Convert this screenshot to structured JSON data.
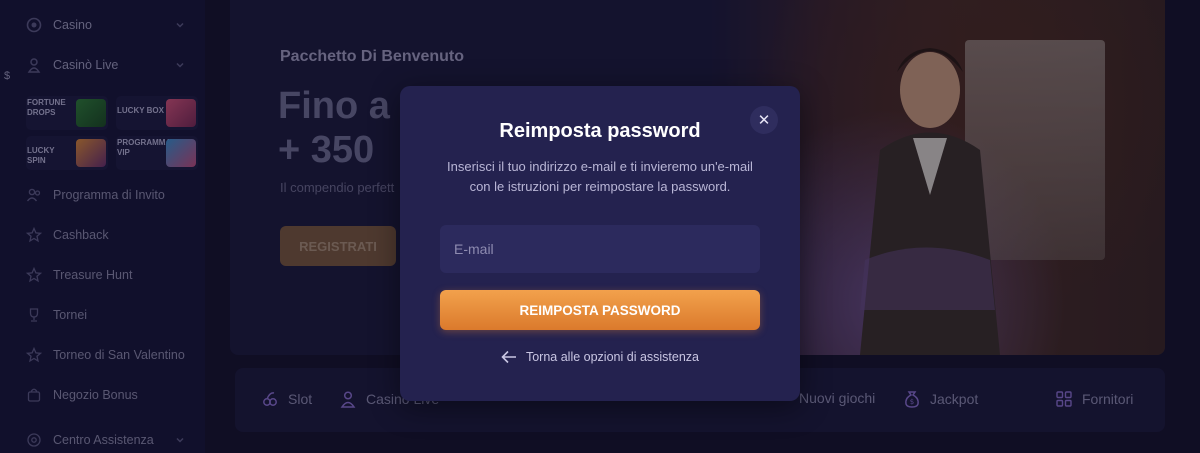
{
  "sidebar": {
    "items_top": [
      {
        "label": "Casino",
        "icon": "casino-chip-icon",
        "has_chevron": true
      },
      {
        "label": "Casinò Live",
        "icon": "live-dealer-icon",
        "has_chevron": true
      }
    ],
    "promos": [
      {
        "label": "FORTUNE DROPS",
        "icon": "fortune-drops-image"
      },
      {
        "label": "LUCKY BOX",
        "icon": "lucky-box-image"
      },
      {
        "label": "LUCKY SPIN",
        "icon": "lucky-spin-image"
      },
      {
        "label": "PROGRAMMA VIP",
        "icon": "vip-program-image"
      }
    ],
    "items": [
      {
        "label": "Programma di Invito",
        "icon": "users-icon"
      },
      {
        "label": "Cashback",
        "icon": "star-icon"
      },
      {
        "label": "Treasure Hunt",
        "icon": "star-icon"
      },
      {
        "label": "Tornei",
        "icon": "trophy-icon"
      },
      {
        "label": "Torneo di San Valentino",
        "icon": "star-icon"
      },
      {
        "label": "Negozio Bonus",
        "icon": "shopping-bag-icon"
      },
      {
        "label": "Centro Assistenza",
        "icon": "support-icon",
        "has_chevron": true
      }
    ],
    "stray_char": "$"
  },
  "banner": {
    "welcome": "Pacchetto Di Benvenuto",
    "headline_line1": "Fino a",
    "headline_line2": "+ 350",
    "subline": "Il compendio perfett",
    "register_label": "REGISTRATI"
  },
  "categories": [
    {
      "label": "Slot",
      "icon": "slot-icon"
    },
    {
      "label": "Casinò Live",
      "icon": "live-dealer-icon"
    },
    {
      "label": "Nuovi giochi",
      "icon": "new-games-icon"
    },
    {
      "label": "Jackpot",
      "icon": "jackpot-bag-icon"
    },
    {
      "label": "Fornitori",
      "icon": "providers-grid-icon"
    }
  ],
  "modal": {
    "title": "Reimposta password",
    "description_line1": "Inserisci il tuo indirizzo e-mail e ti invieremo un'e-mail",
    "description_line2": "con le istruzioni per reimpostare la password.",
    "email_placeholder": "E-mail",
    "email_value": "",
    "submit_label": "REIMPOSTA PASSWORD",
    "back_label": "Torna alle opzioni di assistenza",
    "close_glyph": "✕"
  },
  "colors": {
    "background": "#15132e",
    "modal_bg": "#24224f",
    "accent_orange": "#e88a38",
    "text_muted": "#8b88ab"
  }
}
